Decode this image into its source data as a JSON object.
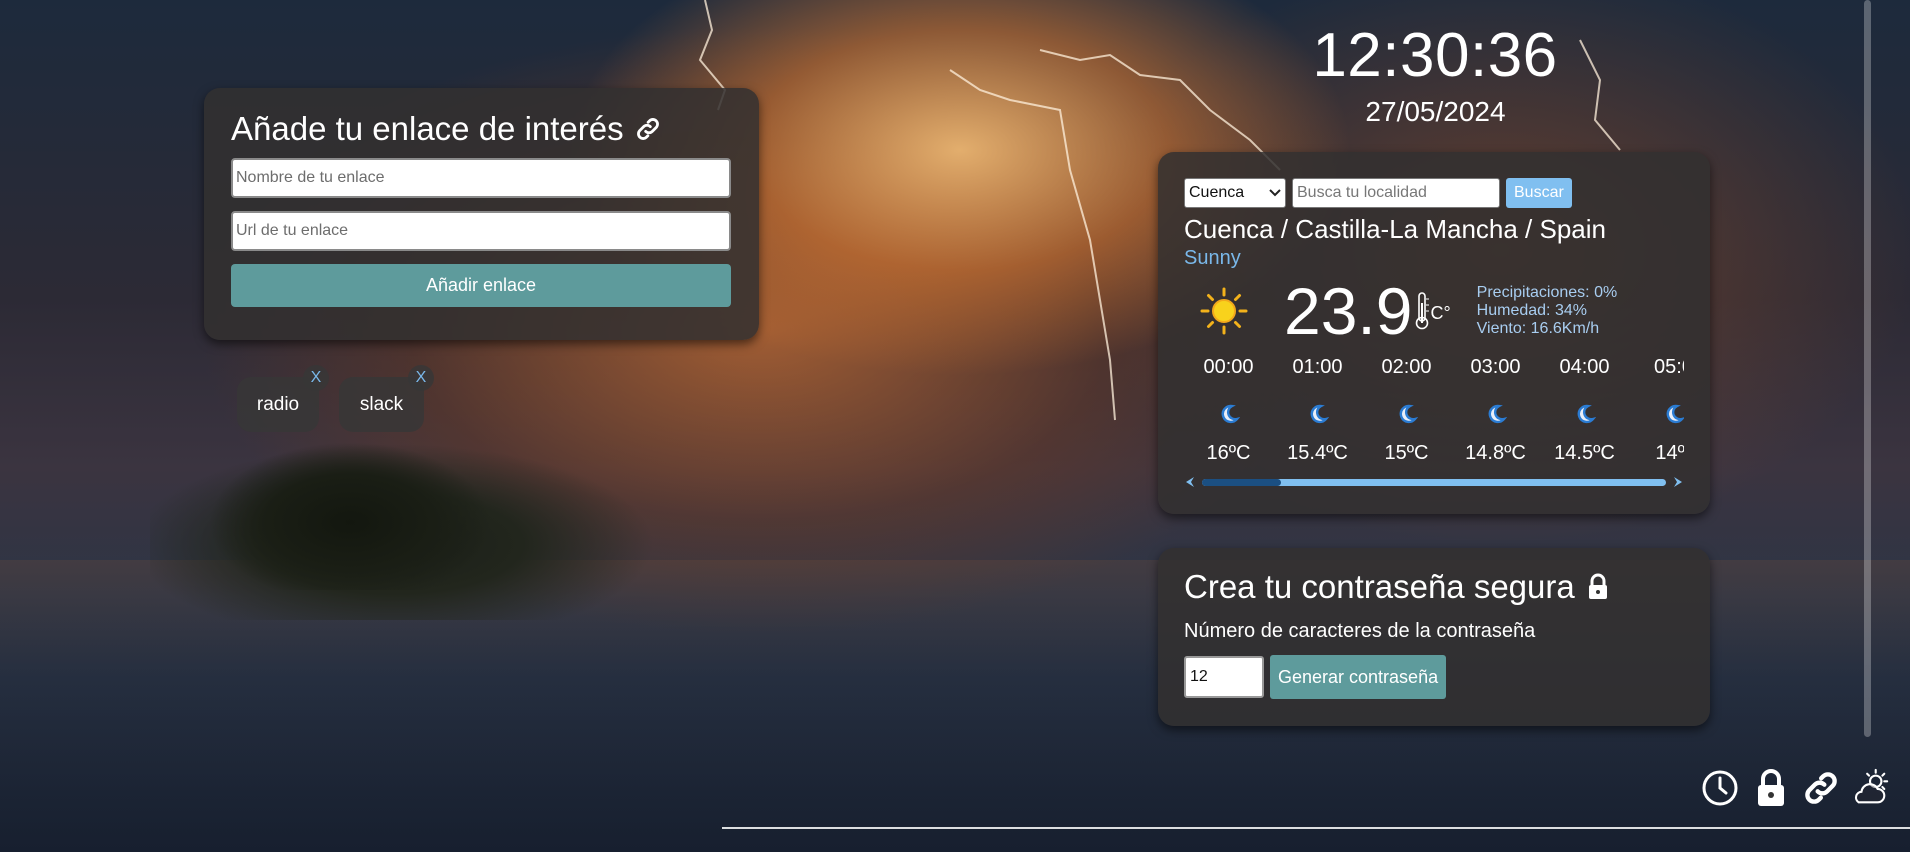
{
  "links_form": {
    "title": "Añade tu enlace de interés",
    "name_placeholder": "Nombre de tu enlace",
    "url_placeholder": "Url de tu enlace",
    "add_button": "Añadir enlace"
  },
  "saved_links": [
    {
      "label": "radio",
      "remove": "X"
    },
    {
      "label": "slack",
      "remove": "X"
    }
  ],
  "clock": {
    "time": "12:30:36",
    "date": "27/05/2024"
  },
  "weather": {
    "selected_city": "Cuenca",
    "search_placeholder": "Busca tu localidad",
    "search_button": "Buscar",
    "location": "Cuenca / Castilla-La Mancha / Spain",
    "condition": "Sunny",
    "temperature": "23.9",
    "unit": "C°",
    "precipitation": "Precipitaciones: 0%",
    "humidity": "Humedad: 34%",
    "wind": "Viento: 16.6Km/h",
    "hourly": [
      {
        "time": "00:00",
        "icon": "moon-icon",
        "temp": "16ºC"
      },
      {
        "time": "01:00",
        "icon": "moon-icon",
        "temp": "15.4ºC"
      },
      {
        "time": "02:00",
        "icon": "moon-icon",
        "temp": "15ºC"
      },
      {
        "time": "03:00",
        "icon": "moon-icon",
        "temp": "14.8ºC"
      },
      {
        "time": "04:00",
        "icon": "moon-icon",
        "temp": "14.5ºC"
      },
      {
        "time": "05:0",
        "icon": "moon-icon",
        "temp": "14º("
      }
    ],
    "scroll_position": 0.17
  },
  "password": {
    "title": "Crea tu contraseña segura",
    "length_label": "Número de caracteres de la contraseña",
    "length_value": "12",
    "generate_button": "Generar contraseña"
  },
  "nav": {
    "icons": [
      "clock-icon",
      "lock-icon",
      "link-icon",
      "partly-cloudy-icon"
    ]
  },
  "colors": {
    "teal": "#5e9b9c",
    "accent_blue": "#80bff0",
    "panel": "#323030"
  }
}
